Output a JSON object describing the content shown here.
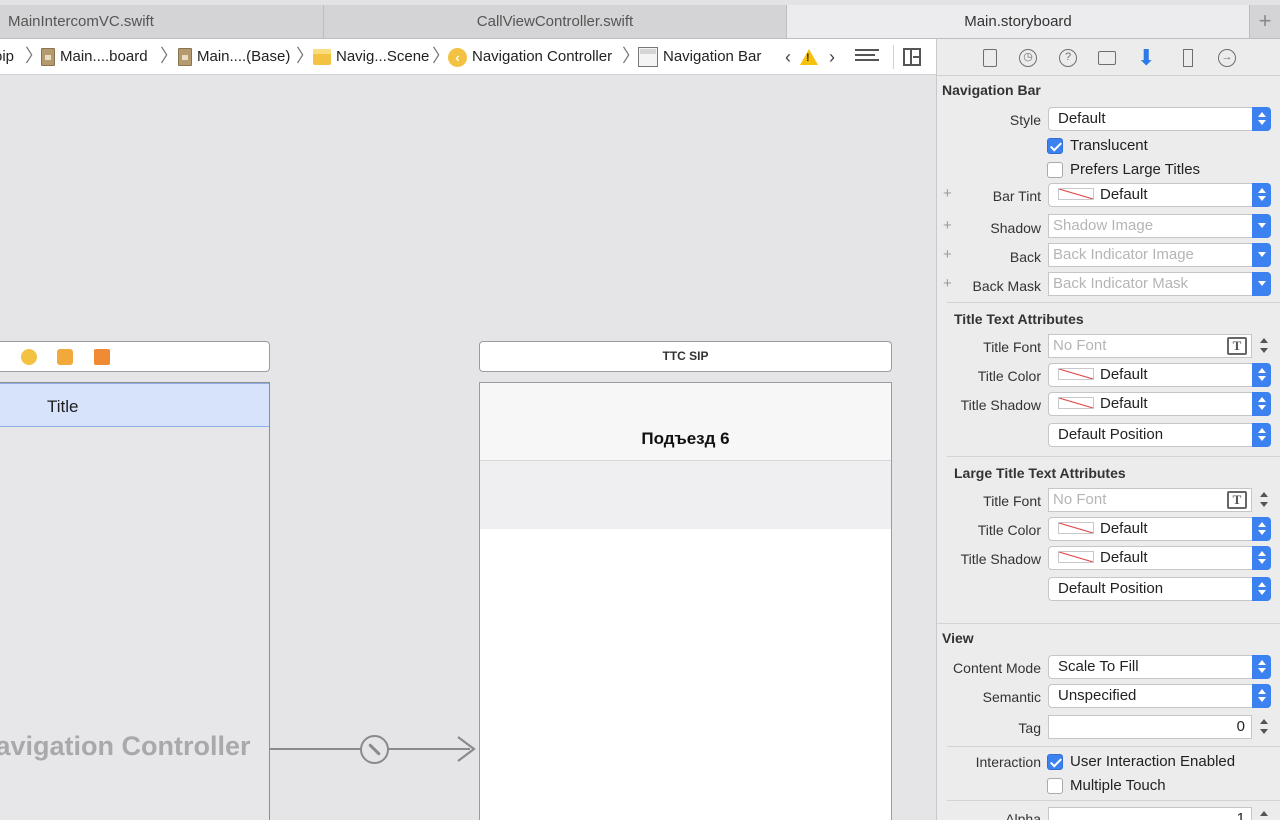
{
  "tabs": [
    {
      "label": "MainIntercomVC.swift"
    },
    {
      "label": "CallViewController.swift"
    },
    {
      "label": "Main.storyboard"
    }
  ],
  "tab_add": "+",
  "breadcrumbs": [
    {
      "label": "oip"
    },
    {
      "label": "Main....board"
    },
    {
      "label": "Main....(Base)"
    },
    {
      "label": "Navig...Scene"
    },
    {
      "label": "Navigation Controller"
    },
    {
      "label": "Navigation Bar"
    }
  ],
  "canvas": {
    "left_scene": {
      "title": "Title",
      "big_label": "Navigation Controller"
    },
    "right_scene": {
      "scene_title": "TTC SIP",
      "nav_title": "Подъезд 6"
    }
  },
  "inspector": {
    "navigation_bar": {
      "title": "Navigation Bar",
      "style_label": "Style",
      "style_value": "Default",
      "translucent_label": "Translucent",
      "translucent_checked": true,
      "large_titles_label": "Prefers Large Titles",
      "large_titles_checked": false,
      "bar_tint_label": "Bar Tint",
      "bar_tint_value": "Default",
      "shadow_label": "Shadow",
      "shadow_placeholder": "Shadow Image",
      "back_label": "Back",
      "back_placeholder": "Back Indicator Image",
      "back_mask_label": "Back Mask",
      "back_mask_placeholder": "Back Indicator Mask"
    },
    "title_text": {
      "title": "Title Text Attributes",
      "font_label": "Title Font",
      "font_placeholder": "No Font",
      "color_label": "Title Color",
      "color_value": "Default",
      "shadow_label": "Title Shadow",
      "shadow_value": "Default",
      "position_value": "Default Position"
    },
    "large_title_text": {
      "title": "Large Title Text Attributes",
      "font_label": "Title Font",
      "font_placeholder": "No Font",
      "color_label": "Title Color",
      "color_value": "Default",
      "shadow_label": "Title Shadow",
      "shadow_value": "Default",
      "position_value": "Default Position"
    },
    "view": {
      "title": "View",
      "content_mode_label": "Content Mode",
      "content_mode_value": "Scale To Fill",
      "semantic_label": "Semantic",
      "semantic_value": "Unspecified",
      "tag_label": "Tag",
      "tag_value": "0",
      "interaction_label": "Interaction",
      "user_interaction_label": "User Interaction Enabled",
      "user_interaction_checked": true,
      "multiple_touch_label": "Multiple Touch",
      "multiple_touch_checked": false,
      "alpha_label": "Alpha",
      "alpha_value": "1"
    }
  },
  "colors": {
    "accent": "#3b82f0",
    "scene_icon": "#f4c243",
    "selection": "#d6e3fa"
  }
}
